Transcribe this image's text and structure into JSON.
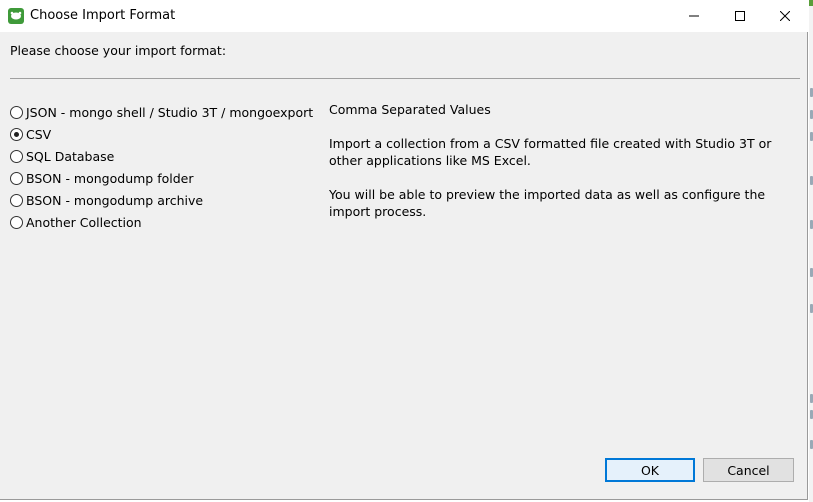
{
  "window": {
    "title": "Choose Import Format",
    "controls": {
      "minimize": "minimize-icon",
      "maximize": "maximize-icon",
      "close": "close-icon"
    }
  },
  "prompt": "Please choose your import format:",
  "options": [
    {
      "label": "JSON - mongo shell / Studio 3T / mongoexport",
      "selected": false
    },
    {
      "label": "CSV",
      "selected": true
    },
    {
      "label": "SQL Database",
      "selected": false
    },
    {
      "label": "BSON - mongodump folder",
      "selected": false
    },
    {
      "label": "BSON - mongodump archive",
      "selected": false
    },
    {
      "label": "Another Collection",
      "selected": false
    }
  ],
  "description": {
    "title": "Comma Separated Values",
    "body1": "Import a collection from a CSV formatted file created with Studio 3T or other applications like MS Excel.",
    "body2": "You will be able to preview the imported data as well as configure the import process."
  },
  "buttons": {
    "ok": "OK",
    "cancel": "Cancel"
  },
  "colors": {
    "focus_border": "#0078d7",
    "dialog_bg": "#f0f0f0",
    "app_icon": "#3f9a3a"
  }
}
